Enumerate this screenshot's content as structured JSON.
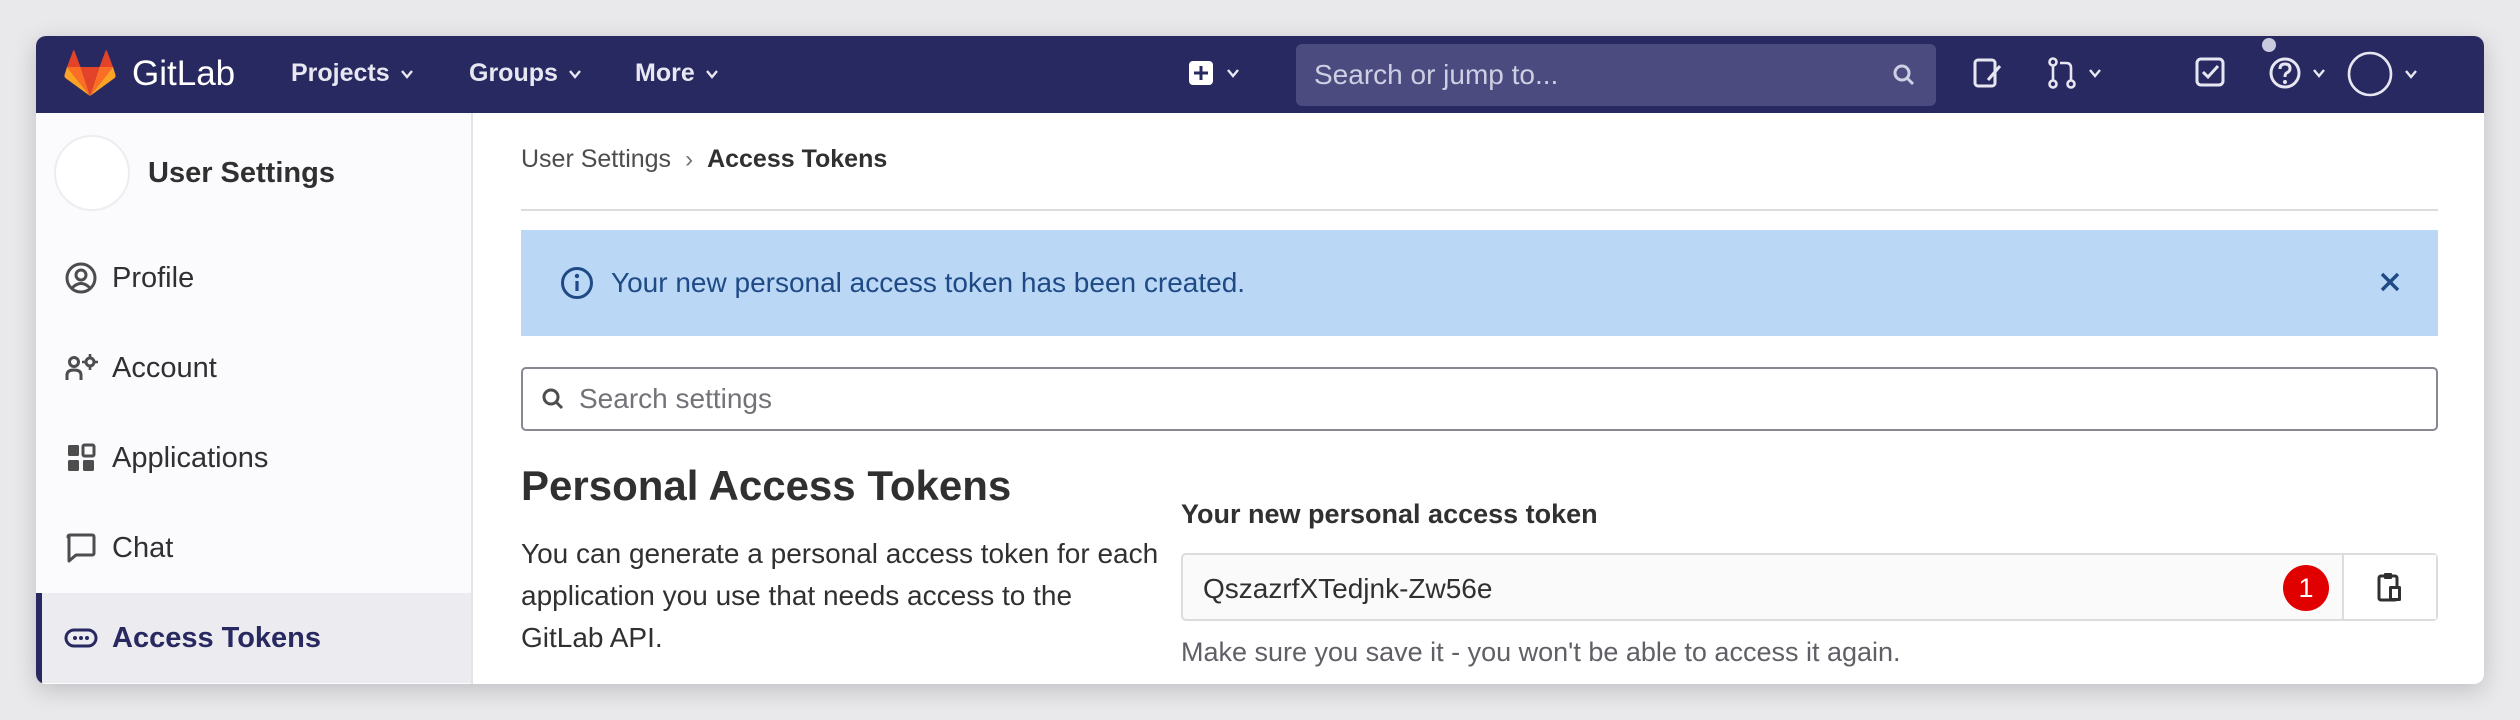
{
  "topbar": {
    "brand": "GitLab",
    "nav": [
      {
        "label": "Projects"
      },
      {
        "label": "Groups"
      },
      {
        "label": "More"
      }
    ],
    "search_placeholder": "Search or jump to...",
    "icons": [
      "plus-square-icon",
      "search-icon",
      "issues-icon",
      "merge-request-icon",
      "todo-check-icon",
      "help-icon",
      "user-avatar-icon"
    ],
    "colors": {
      "bar": "#292961",
      "search_bg": "#4b4b80"
    }
  },
  "sidebar": {
    "title": "User Settings",
    "items": [
      {
        "label": "Profile",
        "icon": "profile-icon"
      },
      {
        "label": "Account",
        "icon": "account-icon"
      },
      {
        "label": "Applications",
        "icon": "applications-icon"
      },
      {
        "label": "Chat",
        "icon": "chat-icon"
      },
      {
        "label": "Access Tokens",
        "icon": "token-icon",
        "active": true
      }
    ]
  },
  "breadcrumb": {
    "parent": "User Settings",
    "separator": "›",
    "current": "Access Tokens"
  },
  "alert": {
    "message": "Your new personal access token has been created.",
    "color": "#bad8f5"
  },
  "settings_search": {
    "placeholder": "Search settings"
  },
  "section": {
    "title": "Personal Access Tokens",
    "description": "You can generate a personal access token for each application you use that needs access to the GitLab API."
  },
  "new_token": {
    "label": "Your new personal access token",
    "value": "QszazrfXTedjnk-Zw56e",
    "badge": "1",
    "help": "Make sure you save it - you won't be able to access it again."
  }
}
